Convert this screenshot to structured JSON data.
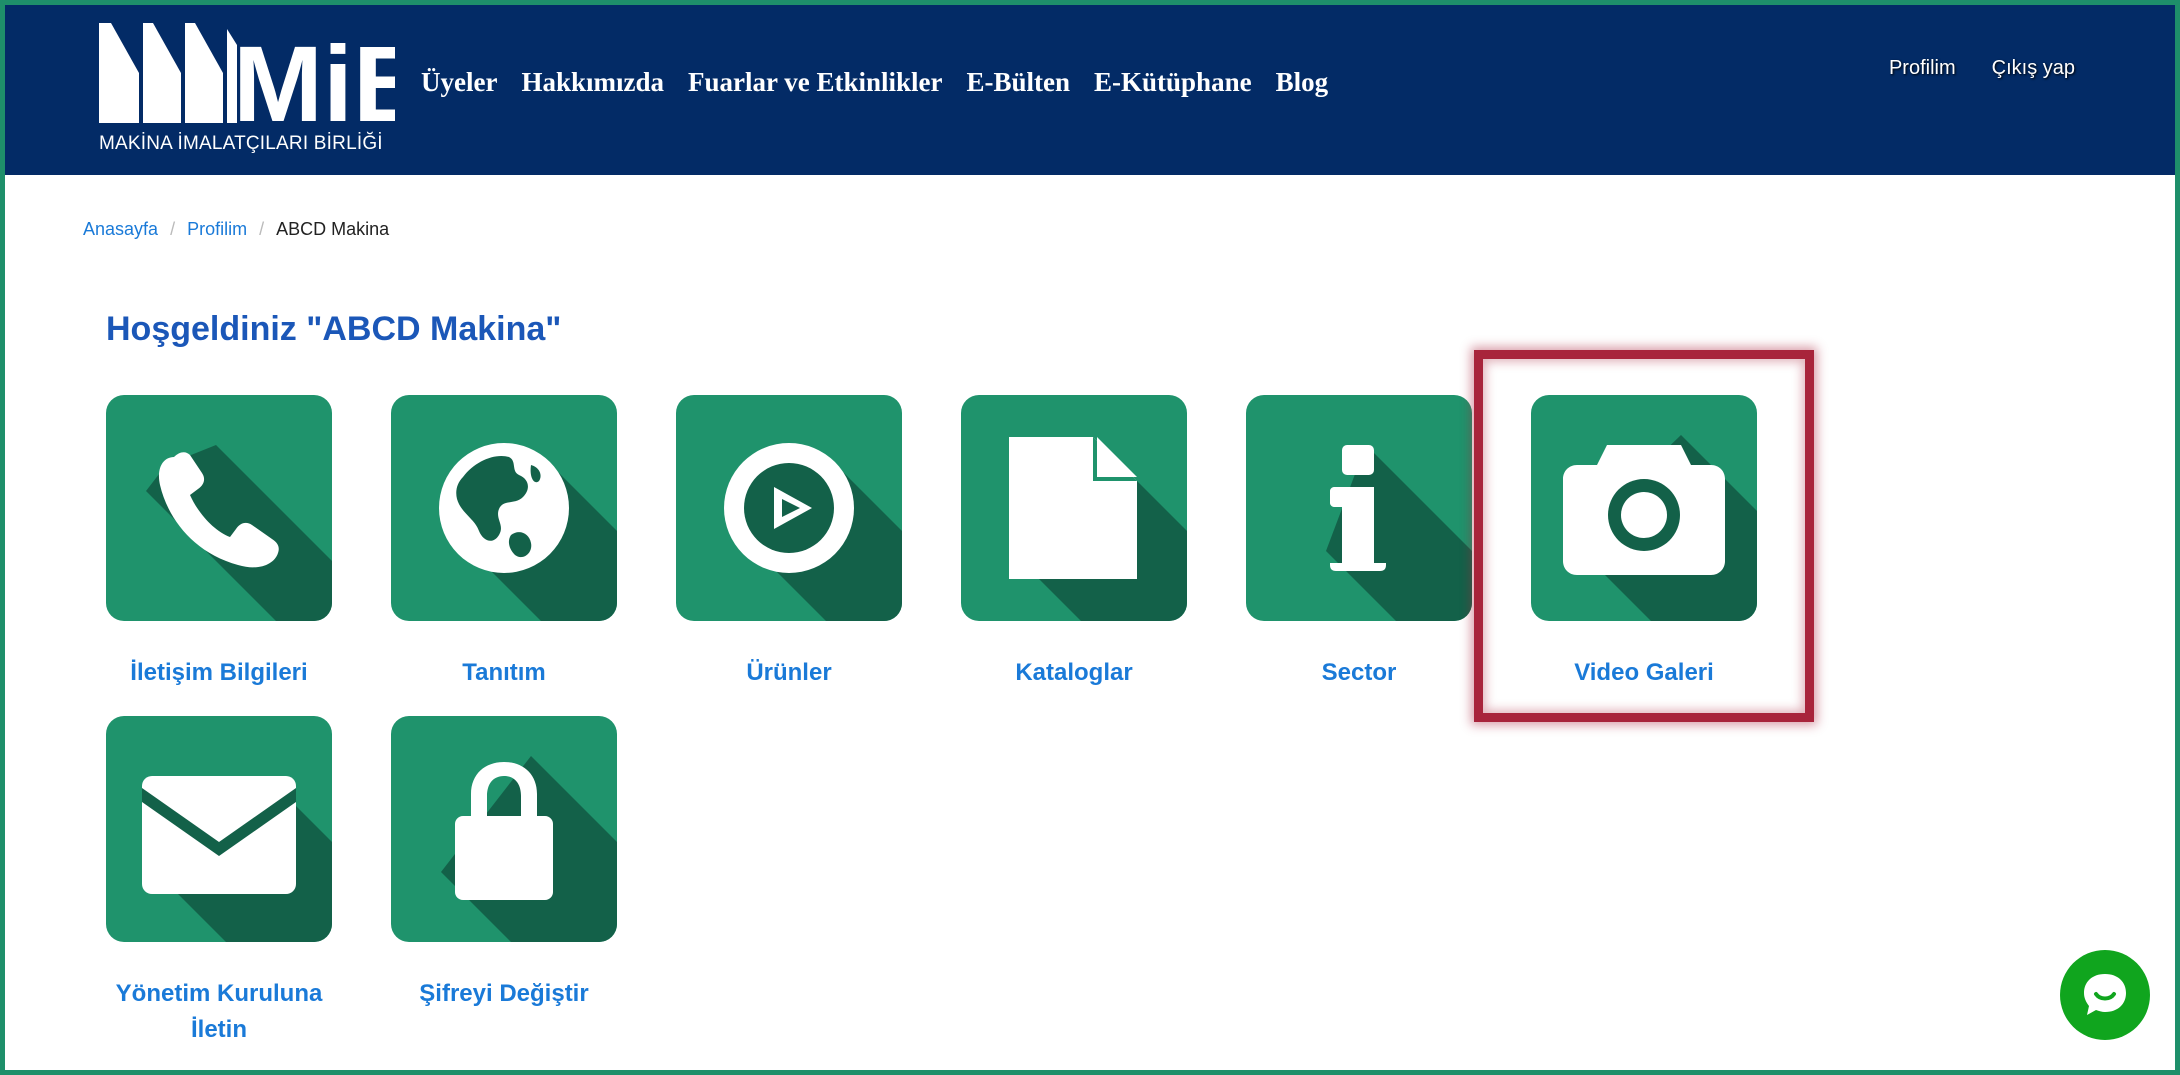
{
  "header": {
    "logo_text": "MİB",
    "logo_subtitle": "MAKİNA İMALATÇILARI BİRLİĞİ",
    "nav": [
      {
        "label": "Üyeler"
      },
      {
        "label": "Hakkımızda"
      },
      {
        "label": "Fuarlar ve Etkinlikler"
      },
      {
        "label": "E-Bülten"
      },
      {
        "label": "E-Kütüphane"
      },
      {
        "label": "Blog"
      }
    ],
    "profile_label": "Profilim",
    "logout_label": "Çıkış yap"
  },
  "breadcrumb": {
    "home": "Anasayfa",
    "separator": "/",
    "profile": "Profilim",
    "current": "ABCD Makina"
  },
  "welcome_title": "Hoşgeldiniz \"ABCD Makina\"",
  "tiles": [
    {
      "label": "İletişim Bilgileri",
      "icon": "phone-icon"
    },
    {
      "label": "Tanıtım",
      "icon": "globe-icon"
    },
    {
      "label": "Ürünler",
      "icon": "play-circle-icon"
    },
    {
      "label": "Kataloglar",
      "icon": "document-icon"
    },
    {
      "label": "Sector",
      "icon": "info-icon"
    },
    {
      "label": "Video Galeri",
      "icon": "camera-icon"
    },
    {
      "label": "Yönetim Kuruluna İletin",
      "icon": "envelope-icon"
    },
    {
      "label": "Şifreyi Değiştir",
      "icon": "lock-icon"
    }
  ],
  "colors": {
    "header_bg": "#032b66",
    "tile_bg": "#1f936c",
    "tile_shadow": "#136149",
    "link": "#1a7ad8",
    "highlight": "#a8243b",
    "chat": "#10a51e",
    "frame": "#1e8f6a"
  }
}
